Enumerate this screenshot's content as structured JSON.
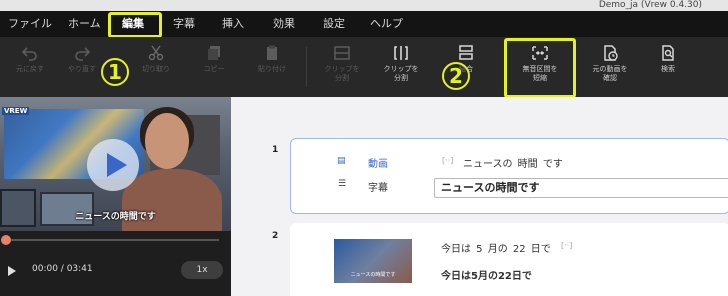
{
  "window": {
    "title": "Demo_ja (Vrew 0.4.30)"
  },
  "menu": {
    "items": [
      {
        "label": "ファイル"
      },
      {
        "label": "ホーム"
      },
      {
        "label": "編集"
      },
      {
        "label": "字幕"
      },
      {
        "label": "挿入"
      },
      {
        "label": "効果"
      },
      {
        "label": "設定"
      },
      {
        "label": "ヘルプ"
      }
    ],
    "active": "編集"
  },
  "toolbar": {
    "undo": "元に戻す",
    "redo": "やり直す",
    "cut": "切り取り",
    "copy": "コピー",
    "paste": "貼り付け",
    "clip_split_disabled": "クリップを\n分割",
    "clip_split": "クリップを\n分割",
    "merge": "結合",
    "trim_silence": "無音区間を\n短縮",
    "original_video": "元の動画を\n確認",
    "search": "検索"
  },
  "callouts": {
    "one": "1",
    "two": "2"
  },
  "player": {
    "watermark": "VREW",
    "subtitle": "ニュースの時間です",
    "timecode": "00:00 / 03:41",
    "speed": "1x",
    "progress": 0.0
  },
  "clips": [
    {
      "number": "1",
      "video_label": "動画",
      "subtitle_label": "字幕",
      "bracket": "[··]",
      "words": "ニュースの 時間 です",
      "subtitle_text": "ニュースの時間です"
    },
    {
      "number": "2",
      "thumb_text": "ニュースの時間です",
      "words": "今日は 5 月の 22 日で",
      "bracket": "[··]",
      "subtitle_text": "今日は5月の22日で"
    }
  ],
  "colors": {
    "highlight": "#e4f21f",
    "accent": "#3a66c8",
    "menubar": "#141414",
    "toolbar": "#282828"
  }
}
